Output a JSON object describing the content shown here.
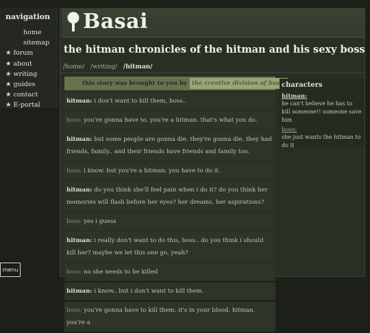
{
  "nav": {
    "title": "navigation",
    "items": [
      {
        "label": "home",
        "star": false
      },
      {
        "label": "sitemap",
        "star": false
      },
      {
        "label": "forum",
        "star": true
      },
      {
        "label": "about",
        "star": true
      },
      {
        "label": "writing",
        "star": true
      },
      {
        "label": "guides",
        "star": true
      },
      {
        "label": "contact",
        "star": true
      },
      {
        "label": "E-portal",
        "star": true
      }
    ]
  },
  "site": {
    "name": "Basai",
    "logo_icon": "tree-icon"
  },
  "page": {
    "title": "the hitman chronicles of the hitman and his sexy boss",
    "breadcrumb": [
      "/home/",
      "/writing/",
      "/hitman/"
    ]
  },
  "credit": {
    "text": "this story was brought to you by",
    "link": "the creative division of basai"
  },
  "dialog": [
    {
      "speaker": "hitman:",
      "text": "i don't want to kill them, boss.."
    },
    {
      "speaker": "boss:",
      "text": "you're gonna have to. you're a hitman. that's what you do."
    },
    {
      "speaker": "hitman:",
      "text": "but some people are gonna die. they're gonna die. they had friends, family.. and their friends have friends and family too."
    },
    {
      "speaker": "boss:",
      "text": "i know. but you're a hitman. you have to do it."
    },
    {
      "speaker": "hitman:",
      "text": "do you think she'll feel pain when i do it? do you think her memories will flash before her eyes? her dreams, her aspirations?"
    },
    {
      "speaker": "boss:",
      "text": "yes i guess"
    },
    {
      "speaker": "hitman:",
      "text": "i really don't want to do this, boss.. do you think i should kill her? maybe we let this one go, yeah?"
    },
    {
      "speaker": "boss:",
      "text": "no she needs to be killed"
    },
    {
      "speaker": "hitman:",
      "text": "i know.. but i don't want to kill them."
    },
    {
      "speaker": "boss:",
      "text": "you're gonna have to kill them. it's in your blood, hitman. you're a"
    }
  ],
  "characters": {
    "title": "characters",
    "list": [
      {
        "name": "hitman:",
        "desc": "he can't believe he has to kill someone!! someone save him"
      },
      {
        "name": "boss:",
        "desc": "she just wants the hitman to do it"
      }
    ]
  },
  "menu_button": "menu"
}
